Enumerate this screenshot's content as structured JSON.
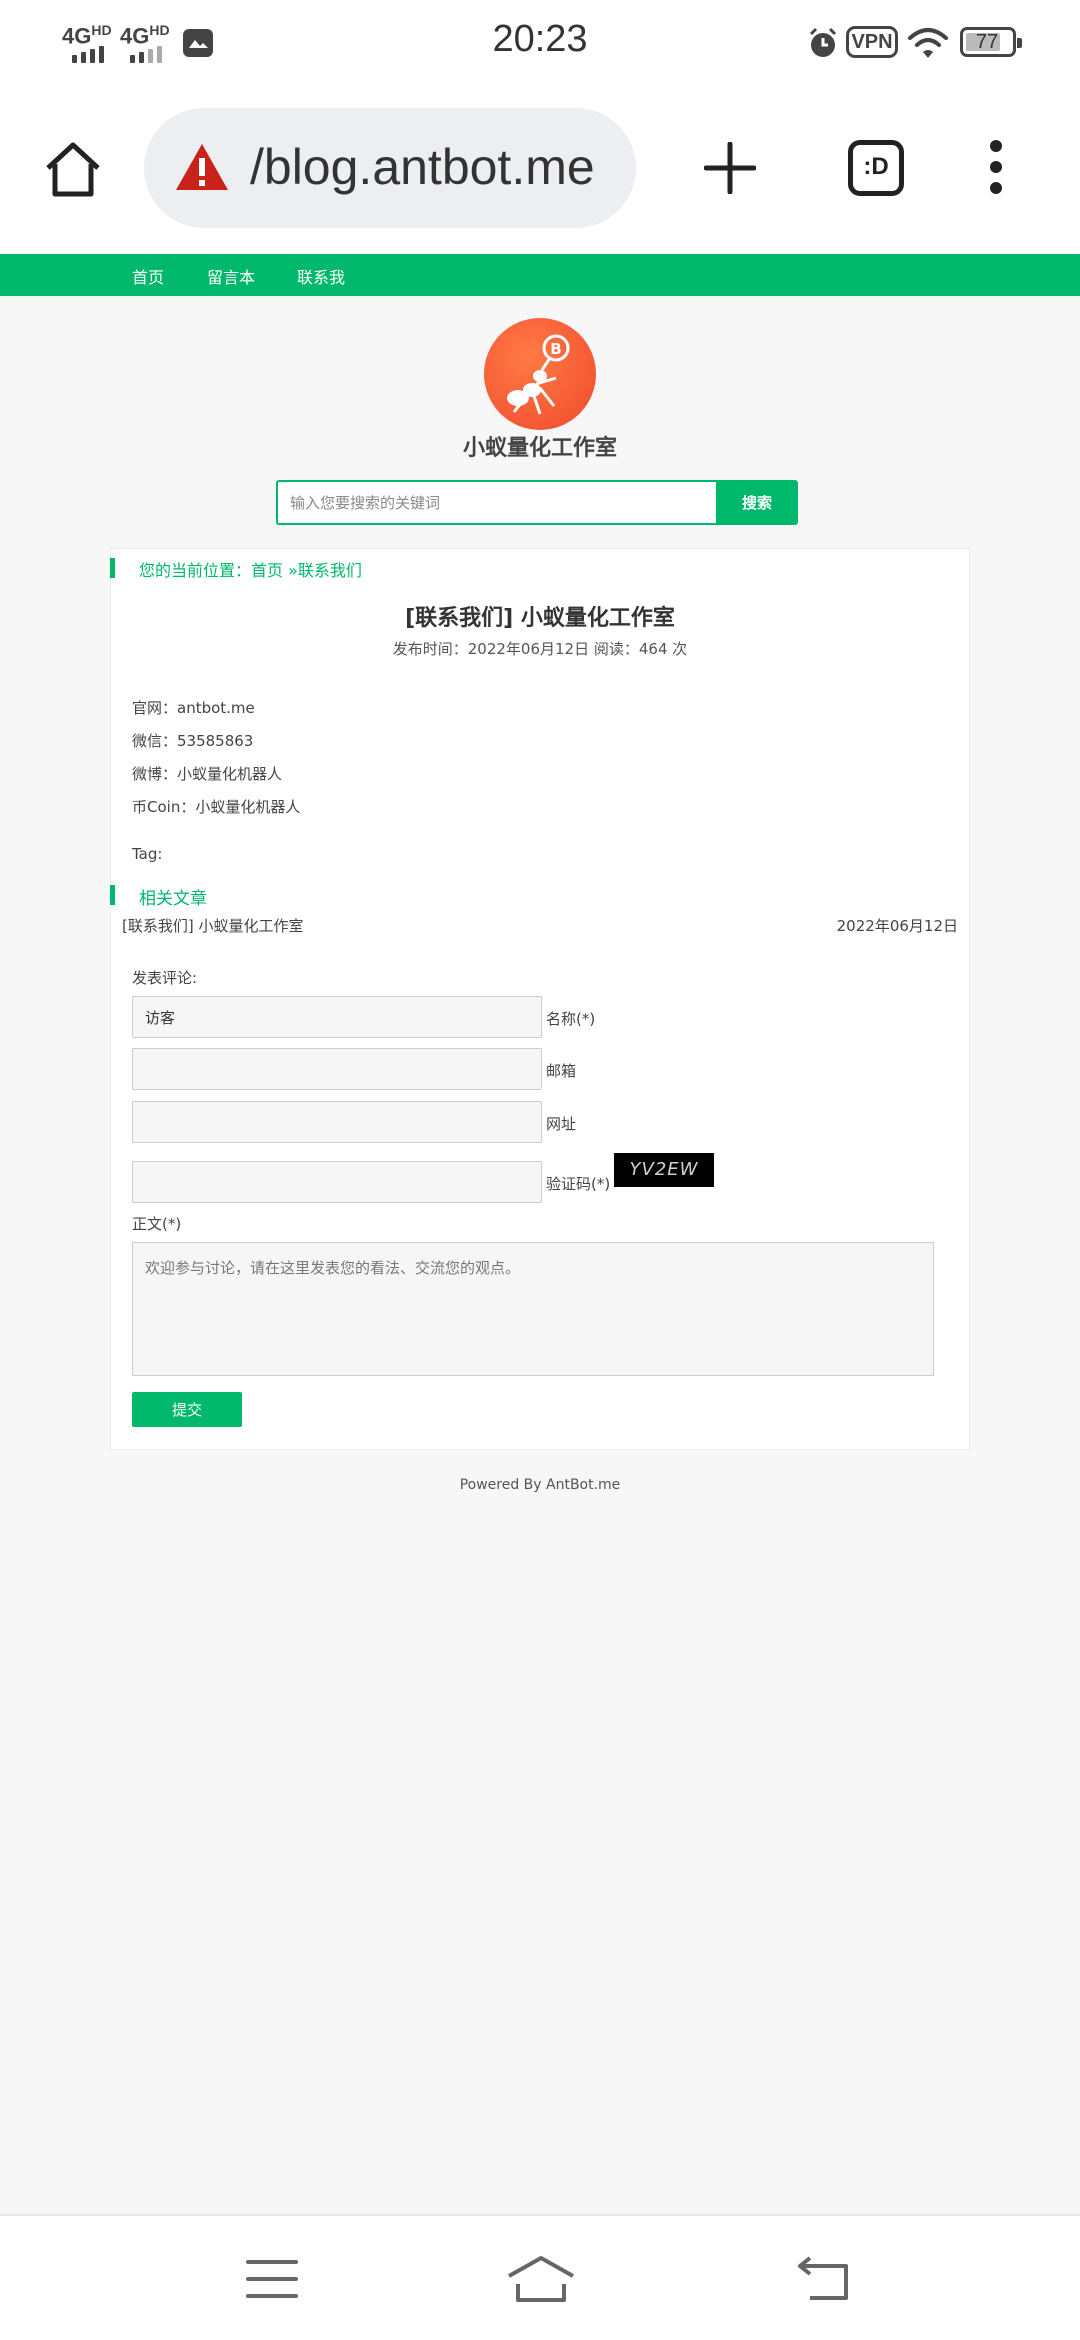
{
  "status_bar": {
    "network1": "4G",
    "network1_sup": "HD",
    "network2": "4G",
    "network2_sup": "HD",
    "time": "20:23",
    "vpn": "VPN",
    "battery": "77",
    "battery_level": 0.77
  },
  "browser": {
    "url": "/blog.antbot.me",
    "tab_label": ":D"
  },
  "nav": {
    "items": [
      {
        "label": "首页"
      },
      {
        "label": "留言本"
      },
      {
        "label": "联系我"
      }
    ]
  },
  "site": {
    "title": "小蚁量化工作室"
  },
  "search": {
    "placeholder": "输入您要搜索的关键词",
    "button": "搜索"
  },
  "breadcrumb": {
    "text": "您的当前位置：首页 »联系我们"
  },
  "article": {
    "title": "[联系我们] 小蚁量化工作室",
    "meta": "发布时间：2022年06月12日 阅读：464 次",
    "lines": [
      "官网：antbot.me",
      "微信：53585863",
      "微博：小蚁量化机器人",
      "币Coin：小蚁量化机器人"
    ],
    "tag": "Tag:"
  },
  "related": {
    "heading": "相关文章",
    "items": [
      {
        "title": "[联系我们] 小蚁量化工作室",
        "date": "2022年06月12日"
      }
    ]
  },
  "comment_form": {
    "heading": "发表评论:",
    "name_value": "访客",
    "name_label": "名称(*)",
    "email_label": "邮箱",
    "url_label": "网址",
    "captcha_label": "验证码(*)",
    "captcha_text": "YV2EW",
    "body_label": "正文(*)",
    "body_placeholder": "欢迎参与讨论，请在这里发表您的看法、交流您的观点。",
    "submit": "提交"
  },
  "footer": {
    "text": "Powered By AntBot.me"
  },
  "colors": {
    "accent": "#00b86b",
    "logo": "#f25a32"
  }
}
